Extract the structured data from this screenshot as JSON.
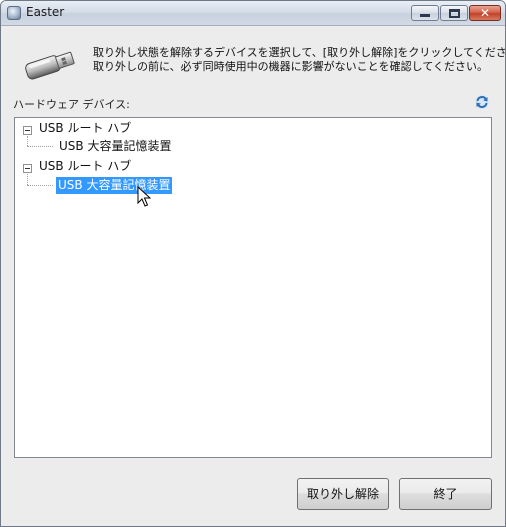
{
  "window": {
    "title": "Easter",
    "close_glyph": "✕"
  },
  "message": {
    "line1": "取り外し状態を解除するデバイスを選択して、[取り外し解除]をクリックしてください。",
    "line2": "取り外しの前に、必ず同時使用中の機器に影響がないことを確認してください。"
  },
  "hardware_label": "ハードウェア デバイス:",
  "tree": {
    "hubs": [
      {
        "label": "USB ルート ハブ",
        "children": [
          {
            "label": "USB 大容量記憶装置",
            "selected": false
          }
        ]
      },
      {
        "label": "USB ルート ハブ",
        "children": [
          {
            "label": "USB 大容量記憶装置",
            "selected": true
          }
        ]
      }
    ]
  },
  "buttons": {
    "remove": "取り外し解除",
    "end": "終了"
  },
  "icons": {
    "app": "app-icon",
    "usb": "usb-drive-icon",
    "refresh": "refresh-icon",
    "cursor": "mouse-cursor-icon"
  },
  "colors": {
    "selection": "#3399ff",
    "window_bg": "#ececec"
  }
}
